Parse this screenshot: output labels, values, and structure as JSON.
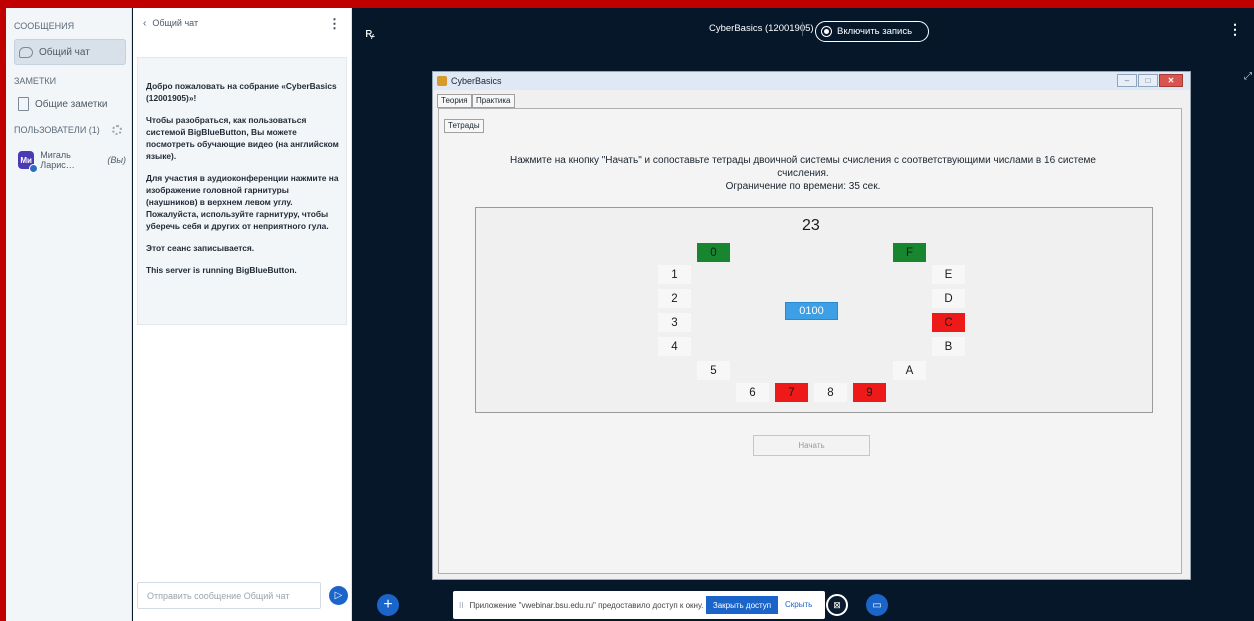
{
  "nav": {
    "messages_header": "СООБЩЕНИЯ",
    "public_chat": "Общий чат",
    "notes_header": "ЗАМЕТКИ",
    "shared_notes": "Общие заметки",
    "users_header": "ПОЛЬЗОВАТЕЛИ (1)",
    "user_initials": "Ми",
    "user_name": "Мигаль Ларис…",
    "user_suffix": "(Вы)"
  },
  "chat": {
    "title": "Общий чат",
    "back": "‹",
    "welcome_1": "Добро пожаловать на собрание «CyberBasics (12001905)»!",
    "welcome_2": "Чтобы разобраться, как пользоваться системой BigBlueButton, Вы можете посмотреть обучающие видео (на английском языке).",
    "welcome_3": "Для участия в аудиоконференции нажмите на изображение головной гарнитуры (наушников) в верхнем левом углу. Пожалуйста, используйте гарнитуру, чтобы уберечь себя и других от неприятного гула.",
    "welcome_4": "Этот сеанс записывается.",
    "welcome_5": "This server is running BigBlueButton.",
    "input_placeholder": "Отправить сообщение Общий чат"
  },
  "main": {
    "meeting_title": "CyberBasics (12001905)",
    "record_label": "Включить запись"
  },
  "window": {
    "title": "CyberBasics",
    "tab_theory": "Теория",
    "tab_practice": "Практика",
    "tab_tetrads": "Тетрады",
    "instruction_1": "Нажмите на кнопку \"Начать\" и сопоставьте тетрады двоичной системы счисления с соответствующими числами в 16 системе счисления.",
    "instruction_2": "Ограничение по времени: 35 сек.",
    "board_number": "23",
    "center_tetrad": "0100",
    "start_label": "Начать",
    "cells": {
      "c0": "0",
      "c1": "1",
      "c2": "2",
      "c3": "3",
      "c4": "4",
      "c5": "5",
      "c6": "6",
      "c7": "7",
      "c8": "8",
      "c9": "9",
      "cA": "A",
      "cB": "B",
      "cC": "C",
      "cD": "D",
      "cE": "E",
      "cF": "F"
    },
    "colors": {
      "green": "#17862f",
      "red": "#ee1a1a",
      "blue": "#3d9fe5"
    }
  },
  "share": {
    "pause": "II",
    "message": "Приложение \"vwebinar.bsu.edu.ru\" предоставило доступ к окну.",
    "stop_label": "Закрыть доступ",
    "hide_label": "Скрыть"
  },
  "icons": {
    "user_toggle": "ꝶ",
    "cam_glyph": "⊠",
    "screen_glyph": "▭"
  }
}
